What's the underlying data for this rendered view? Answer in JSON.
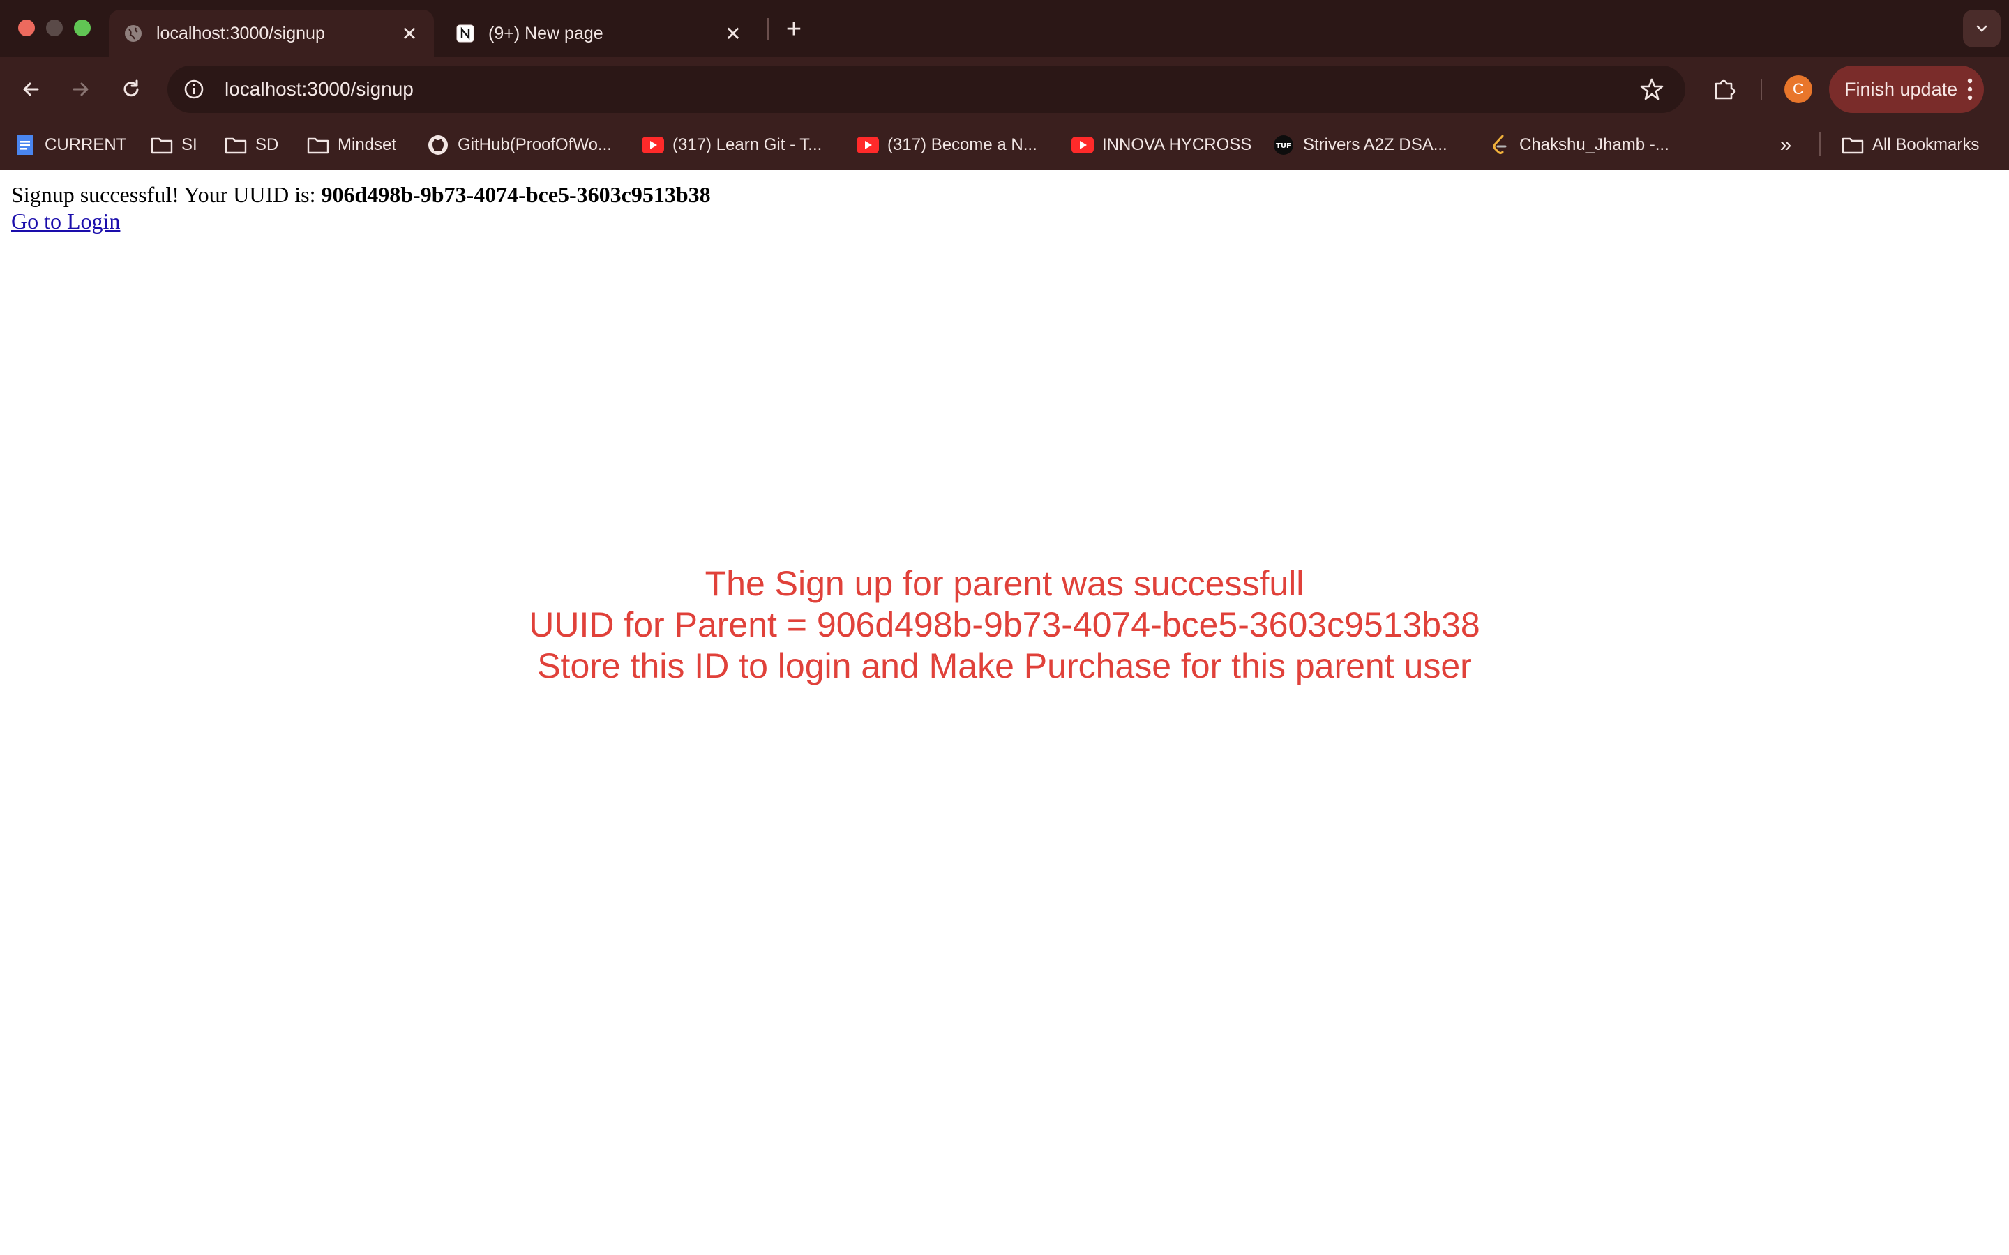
{
  "browser": {
    "tabs": [
      {
        "title": "localhost:3000/signup",
        "favicon": "globe-icon",
        "active": true
      },
      {
        "title": "(9+) New page",
        "favicon": "notion-icon",
        "active": false
      }
    ],
    "address_bar": {
      "url": "localhost:3000/signup"
    },
    "profile_initial": "C",
    "finish_update_label": "Finish update",
    "bookmarks": [
      {
        "label": "CURRENT",
        "icon": "docs-icon"
      },
      {
        "label": "SI",
        "icon": "folder-icon"
      },
      {
        "label": "SD",
        "icon": "folder-icon"
      },
      {
        "label": "Mindset",
        "icon": "folder-icon"
      },
      {
        "label": "GitHub(ProofOfWo...",
        "icon": "github-icon"
      },
      {
        "label": "(317) Learn Git - T...",
        "icon": "youtube-icon"
      },
      {
        "label": "(317) Become a N...",
        "icon": "youtube-icon"
      },
      {
        "label": "INNOVA HYCROSS",
        "icon": "youtube-icon"
      },
      {
        "label": "Strivers A2Z DSA...",
        "icon": "tuf-icon"
      },
      {
        "label": "Chakshu_Jhamb -...",
        "icon": "leetcode-icon"
      }
    ],
    "all_bookmarks_label": "All Bookmarks",
    "more_bookmarks_glyph": "»"
  },
  "page": {
    "signup_message_prefix": "Signup successful! Your UUID is: ",
    "uuid": "906d498b-9b73-4074-bce5-3603c9513b38",
    "login_link_label": "Go to Login",
    "notice_lines": [
      "The Sign up for parent was successfull",
      "UUID for Parent = 906d498b-9b73-4074-bce5-3603c9513b38",
      "Store this ID to login and Make Purchase for this parent user"
    ]
  },
  "colors": {
    "chrome_bg": "#3a1f1e",
    "tabstrip_bg": "#2b1716",
    "notice_text": "#e0413a",
    "link": "#1a0dab",
    "avatar": "#e8762b",
    "update_button": "#7a2c2a"
  }
}
